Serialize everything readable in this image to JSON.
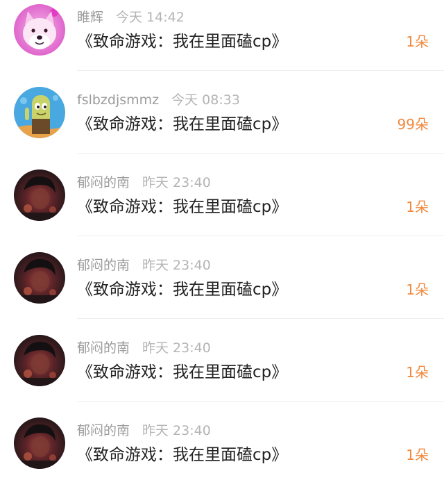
{
  "colors": {
    "username": "#9b9b9b",
    "time": "#b4b4b4",
    "title": "#222222",
    "count": "#f0883c",
    "divider": "#efefef"
  },
  "items": [
    {
      "username": "睢辉",
      "time": "今天 14:42",
      "title": "《致命游戏：我在里面磕cp》",
      "count": "1朵",
      "avatar": "pink-shiba-dog-avatar"
    },
    {
      "username": "fslbzdjsmmz",
      "time": "今天 08:33",
      "title": "《致命游戏：我在里面磕cp》",
      "count": "99朵",
      "avatar": "cartoon-character-avatar"
    },
    {
      "username": "郁闷的南",
      "time": "昨天 23:40",
      "title": "《致命游戏：我在里面磕cp》",
      "count": "1朵",
      "avatar": "dark-portrait-avatar"
    },
    {
      "username": "郁闷的南",
      "time": "昨天 23:40",
      "title": "《致命游戏：我在里面磕cp》",
      "count": "1朵",
      "avatar": "dark-portrait-avatar"
    },
    {
      "username": "郁闷的南",
      "time": "昨天 23:40",
      "title": "《致命游戏：我在里面磕cp》",
      "count": "1朵",
      "avatar": "dark-portrait-avatar"
    },
    {
      "username": "郁闷的南",
      "time": "昨天 23:40",
      "title": "《致命游戏：我在里面磕cp》",
      "count": "1朵",
      "avatar": "dark-portrait-avatar"
    }
  ]
}
